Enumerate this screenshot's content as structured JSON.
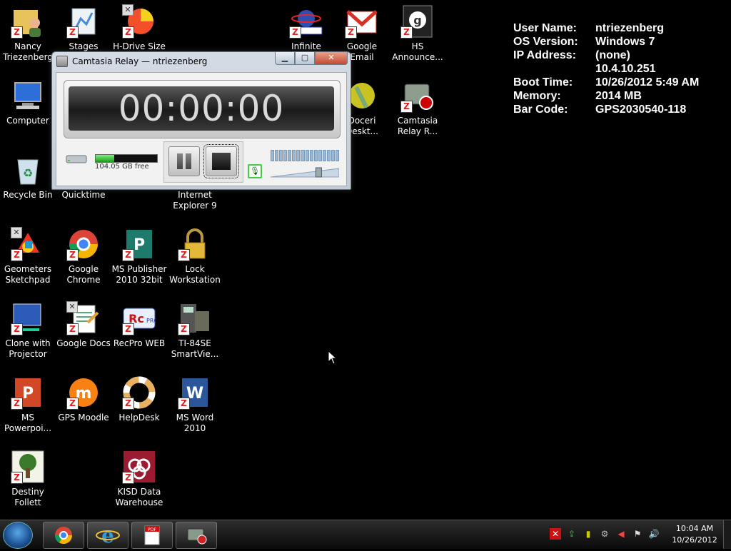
{
  "desktop_icons": [
    {
      "label": "Nancy\nTriezenberg",
      "icon": "user-folder-icon"
    },
    {
      "label": "Stages",
      "icon": "stages-icon"
    },
    {
      "label": "H-Drive Size",
      "icon": "pie-chart-icon"
    },
    {
      "label": "Infinite",
      "icon": "ecampus-icon"
    },
    {
      "label": "Google Email",
      "icon": "gmail-icon"
    },
    {
      "label": "HS\nAnnounce...",
      "icon": "hs-announce-icon"
    },
    {
      "label": "Computer",
      "icon": "computer-icon"
    },
    {
      "label": "Doceri\nDeskt...",
      "icon": "doceri-icon"
    },
    {
      "label": "Camtasia\nRelay R...",
      "icon": "camtasia-relay-icon"
    },
    {
      "label": "Recycle Bin",
      "icon": "recycle-bin-icon"
    },
    {
      "label": "Quicktime",
      "icon": "quicktime-icon"
    },
    {
      "label": "Internet\nExplorer 9",
      "icon": "internet-explorer-icon"
    },
    {
      "label": "Geometers\nSketchpad",
      "icon": "geometers-sketchpad-icon"
    },
    {
      "label": "Google\nChrome",
      "icon": "chrome-icon"
    },
    {
      "label": "MS Publisher\n2010 32bit",
      "icon": "publisher-icon"
    },
    {
      "label": "Lock\nWorkstation",
      "icon": "lock-icon"
    },
    {
      "label": "Clone with\nProjector",
      "icon": "clone-projector-icon"
    },
    {
      "label": "Google Docs",
      "icon": "google-docs-icon"
    },
    {
      "label": "RecPro WEB",
      "icon": "recpro-icon"
    },
    {
      "label": "TI-84SE\nSmartVie...",
      "icon": "calculator-icon"
    },
    {
      "label": "MS\nPowerpoi...",
      "icon": "powerpoint-icon"
    },
    {
      "label": "GPS Moodle",
      "icon": "moodle-icon"
    },
    {
      "label": "HelpDesk",
      "icon": "lifebuoy-icon"
    },
    {
      "label": "MS Word\n2010",
      "icon": "word-icon"
    },
    {
      "label": "Destiny\nFollett",
      "icon": "tree-icon"
    },
    {
      "label": "KISD Data\nWarehouse",
      "icon": "data-warehouse-icon"
    }
  ],
  "sysinfo": {
    "rows": [
      {
        "key": "User Name:",
        "value": "ntriezenberg"
      },
      {
        "key": "OS Version:",
        "value": "Windows 7"
      },
      {
        "key": "IP Address:",
        "value": "(none)"
      },
      {
        "key": "",
        "value": "10.4.10.251"
      },
      {
        "key": "Boot Time:",
        "value": "10/26/2012 5:49 AM"
      },
      {
        "key": "Memory:",
        "value": "2014 MB"
      },
      {
        "key": "Bar Code:",
        "value": "GPS2030540-118"
      }
    ]
  },
  "camtasia": {
    "title": "Camtasia Relay — ntriezenberg",
    "timer": "00:00:00",
    "disk_free": "104.05 GB free",
    "disk_meter_fraction": 0.3,
    "volume_level": 0.72
  },
  "taskbar": {
    "items": [
      "chrome-taskbar-button",
      "internet-explorer-taskbar-button",
      "pdf-taskbar-button",
      "camtasia-taskbar-button"
    ],
    "clock_time": "10:04 AM",
    "clock_date": "10/26/2012"
  },
  "colors": {
    "desktop": "#000000",
    "accent_green": "#2fbf2f"
  }
}
